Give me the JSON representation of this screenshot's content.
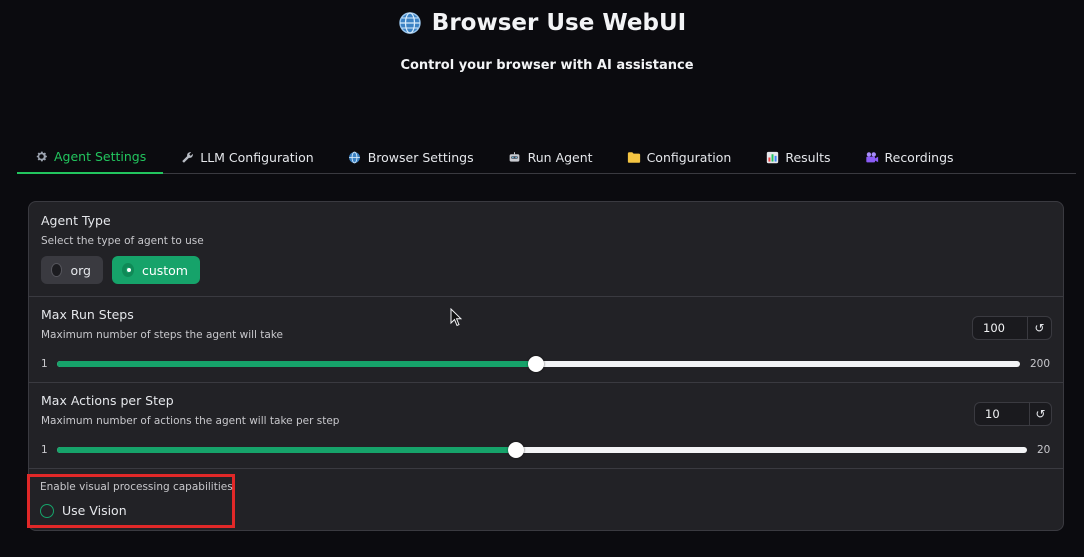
{
  "header": {
    "title": "Browser Use WebUI",
    "subtitle": "Control your browser with AI assistance"
  },
  "tabs": [
    {
      "label": "Agent Settings",
      "icon": "gear-icon",
      "active": true
    },
    {
      "label": "LLM Configuration",
      "icon": "wrench-icon",
      "active": false
    },
    {
      "label": "Browser Settings",
      "icon": "globe-icon",
      "active": false
    },
    {
      "label": "Run Agent",
      "icon": "robot-icon",
      "active": false
    },
    {
      "label": "Configuration",
      "icon": "folder-icon",
      "active": false
    },
    {
      "label": "Results",
      "icon": "chart-icon",
      "active": false
    },
    {
      "label": "Recordings",
      "icon": "camera-icon",
      "active": false
    }
  ],
  "agent_type": {
    "title": "Agent Type",
    "info": "Select the type of agent to use",
    "options": [
      "org",
      "custom"
    ],
    "selected": "custom"
  },
  "max_run_steps": {
    "title": "Max Run Steps",
    "info": "Maximum number of steps the agent will take",
    "value": "100",
    "min": "1",
    "max": "200",
    "fraction": 0.4975
  },
  "max_actions": {
    "title": "Max Actions per Step",
    "info": "Maximum number of actions the agent will take per step",
    "value": "10",
    "min": "1",
    "max": "20",
    "fraction": 0.4737
  },
  "use_vision": {
    "info": "Enable visual processing capabilities",
    "label": "Use Vision",
    "checked": false
  },
  "colors": {
    "accent": "#16a36a",
    "background": "#0b0b0f",
    "panel": "#222226",
    "highlight_border": "#e12828"
  }
}
